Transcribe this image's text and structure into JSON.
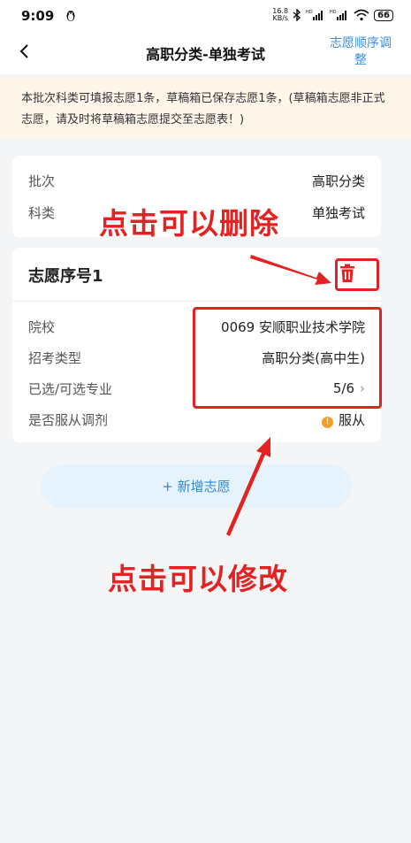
{
  "status_bar": {
    "time": "9:09",
    "net_speed_value": "16.8",
    "net_speed_unit": "KB/s",
    "battery": "66"
  },
  "navbar": {
    "back_icon": "chevron-left-icon",
    "title": "高职分类-单独考试",
    "action_line1": "志愿顺序调",
    "action_line2": "整"
  },
  "notice": {
    "text": "本批次科类可填报志愿1条，草稿箱已保存志愿1条，(草稿箱志愿非正式志愿，请及时将草稿箱志愿提交至志愿表！)"
  },
  "batch_card": {
    "rows": [
      {
        "label": "批次",
        "value": "高职分类"
      },
      {
        "label": "科类",
        "value": "单独考试"
      }
    ]
  },
  "choice_card": {
    "title": "志愿序号1",
    "delete_icon": "trash-icon",
    "rows": [
      {
        "label": "院校",
        "value": "0069 安顺职业技术学院"
      },
      {
        "label": "招考类型",
        "value": "高职分类(高中生)"
      },
      {
        "label": "已选/可选专业",
        "value": "5/6"
      },
      {
        "label": "是否服从调剂",
        "value": "服从"
      }
    ],
    "dot_icon": "!"
  },
  "add_button": {
    "label": "+ 新增志愿"
  },
  "annotations": {
    "delete_hint": "点击可以删除",
    "edit_hint": "点击可以修改",
    "color": "#e32222"
  },
  "colors": {
    "accent": "#3d8fe0",
    "notice_bg": "#fff6ea",
    "warn_dot": "#f4a02d"
  }
}
